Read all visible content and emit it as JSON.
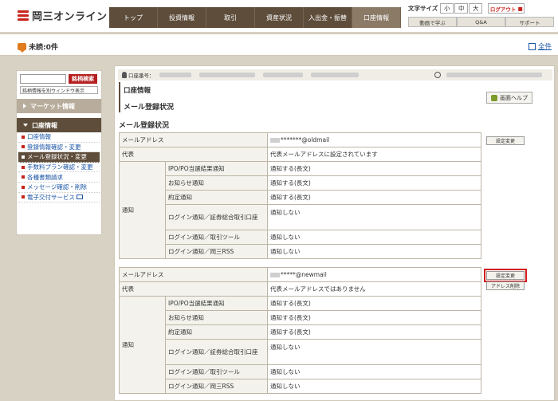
{
  "header": {
    "logo_text": "岡三オンライン",
    "nav": [
      "トップ",
      "投資情報",
      "取引",
      "資産状況",
      "入出金・振替",
      "口座情報"
    ],
    "active_nav": 5,
    "font_size_label": "文字サイズ",
    "font_sizes": [
      "小",
      "中",
      "大"
    ],
    "logout_label": "ログアウト",
    "util_links": [
      "動画で学ぶ",
      "Q&A",
      "サポート"
    ]
  },
  "notice": {
    "unread_text": "未読:0件",
    "all_label": "全件"
  },
  "sidebar": {
    "search_button": "銘柄検索",
    "new_window_label": "銘柄情報を別ウィンドウ表示",
    "market_heading": "マーケット情報",
    "account_heading": "口座情報",
    "items": [
      "口座情報",
      "登録情報確認・変更",
      "メール登録状況・変更",
      "手数料プラン確認・変更",
      "各種書類請求",
      "メッセージ確認・削除",
      "電子交付サービス"
    ],
    "active_index": 2
  },
  "main": {
    "account_label": "口座番号：",
    "title_main": "口座情報",
    "title_sub": "メール登録状況",
    "help_label": "画面ヘルプ",
    "section_heading": "メール登録状況",
    "labels": {
      "mail_address": "メールアドレス",
      "representative": "代表",
      "notification": "通知"
    },
    "notif_types": [
      "IPO/PO当選結果通知",
      "お知らせ通知",
      "約定通知",
      "ログイン通知／証券総合取引口座",
      "ログイン通知／取引ツール",
      "ログイン通知／岡三RSS"
    ],
    "entries": [
      {
        "address_suffix": "*******@oldmail",
        "representative": "代表メールアドレスに設定されています",
        "notif_values": [
          "通知する(長文)",
          "通知する(長文)",
          "通知する(長文)",
          "通知しない",
          "通知しない",
          "通知しない"
        ],
        "change_button": "設定変更"
      },
      {
        "address_suffix": "*****@newmail",
        "representative": "代表メールアドレスではありません",
        "notif_values": [
          "通知する(長文)",
          "通知する(長文)",
          "通知する(長文)",
          "通知しない",
          "通知しない",
          "通知しない"
        ],
        "change_button": "設定変更",
        "delete_button": "アドレス削除"
      }
    ]
  },
  "colors": {
    "nav_bg": "#5e4d3b",
    "accent_red": "#c8241c",
    "link_blue": "#1a55a6",
    "highlight_outline": "#d21c1c"
  }
}
